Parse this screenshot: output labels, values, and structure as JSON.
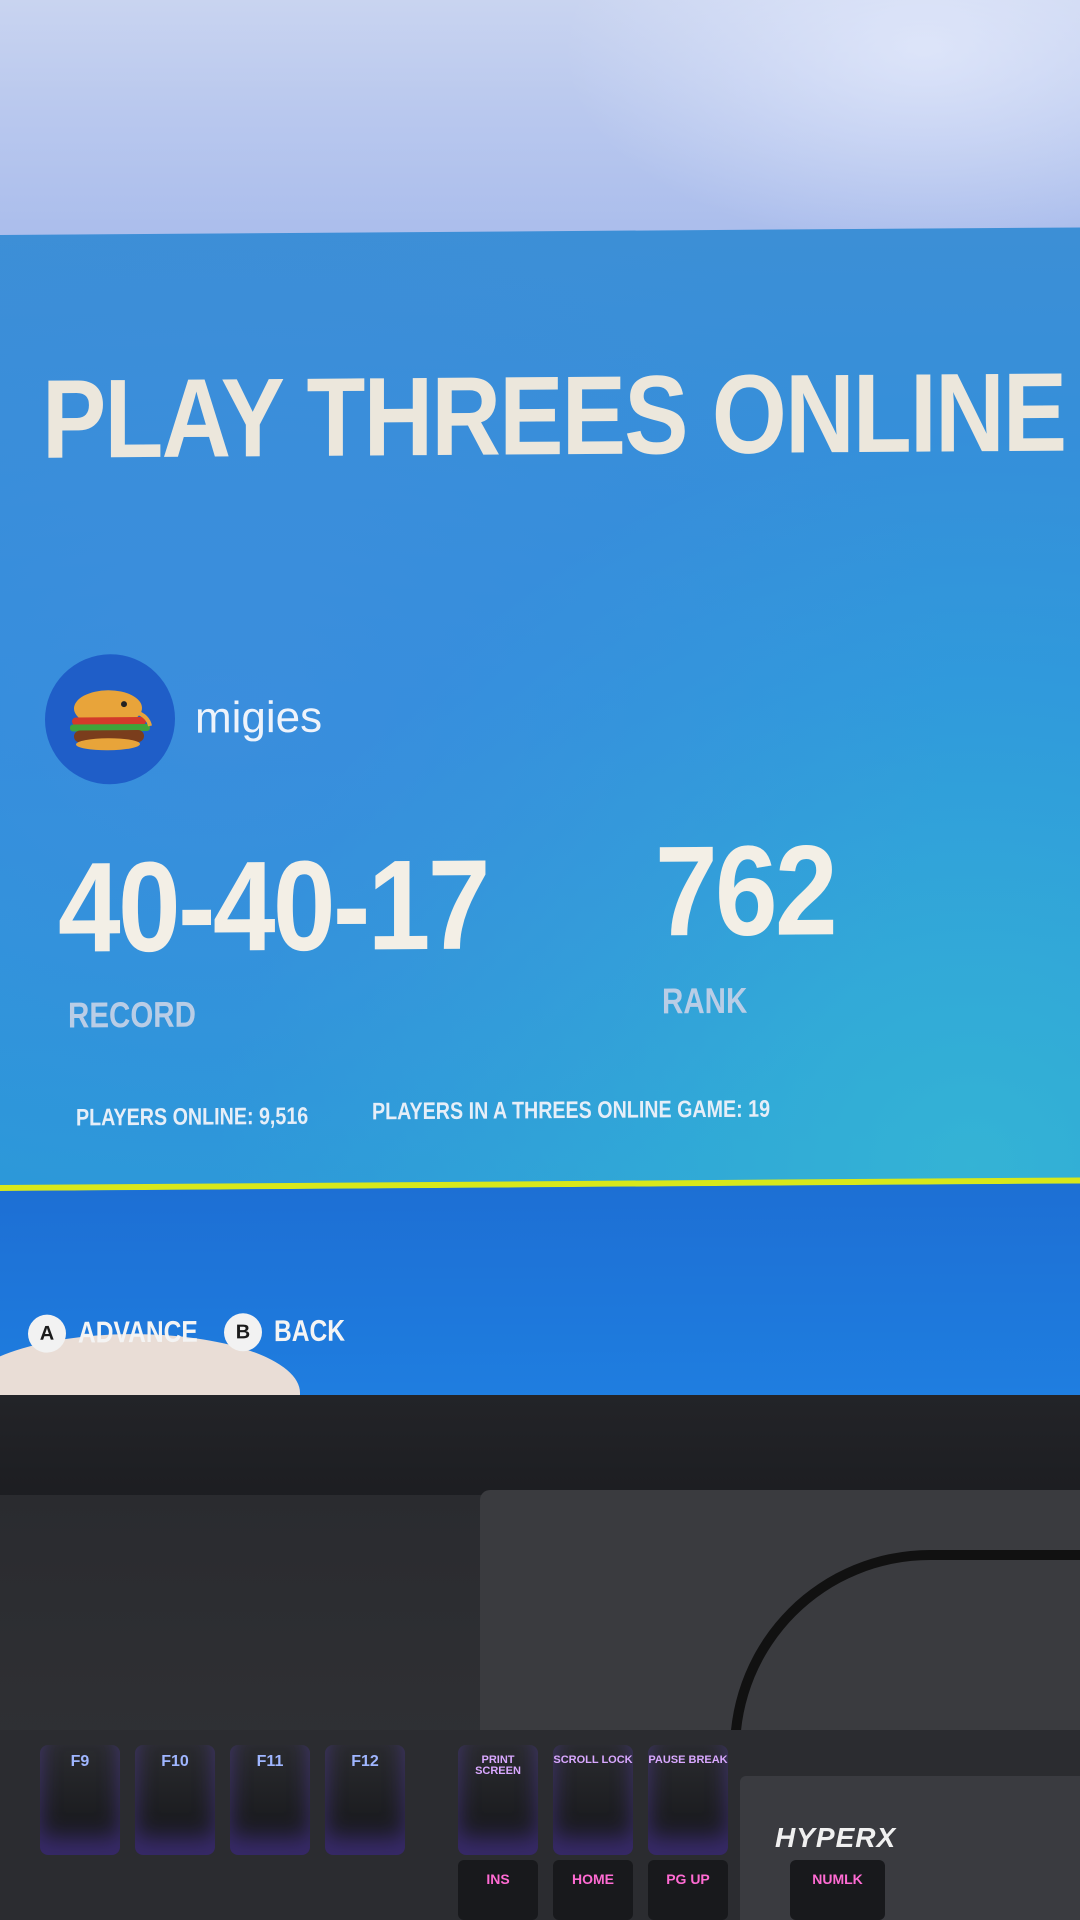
{
  "screen": {
    "title": "PLAY THREES ONLINE",
    "profile": {
      "username": "migies",
      "avatar_icon": "burger-icon"
    },
    "record": {
      "value": "40-40-17",
      "label": "RECORD"
    },
    "rank": {
      "value": "762",
      "label": "RANK"
    },
    "players_online": "PLAYERS ONLINE: 9,516",
    "players_in_game": "PLAYERS IN A THREES ONLINE GAME: 19",
    "hints": [
      {
        "button": "A",
        "label": "ADVANCE"
      },
      {
        "button": "B",
        "label": "BACK"
      }
    ],
    "colors": {
      "screen_blue": "#2d8fde",
      "accent_yellow": "#d8e81a",
      "title_text": "#ece7dc"
    }
  },
  "keyboard": {
    "brand": "HYPERX",
    "top_keys": [
      "F9",
      "F10",
      "F11",
      "F12",
      "PRINT SCREEN",
      "SCROLL LOCK",
      "PAUSE BREAK"
    ],
    "bottom_keys": [
      "INS",
      "HOME",
      "PG UP",
      "NUMLK"
    ]
  }
}
